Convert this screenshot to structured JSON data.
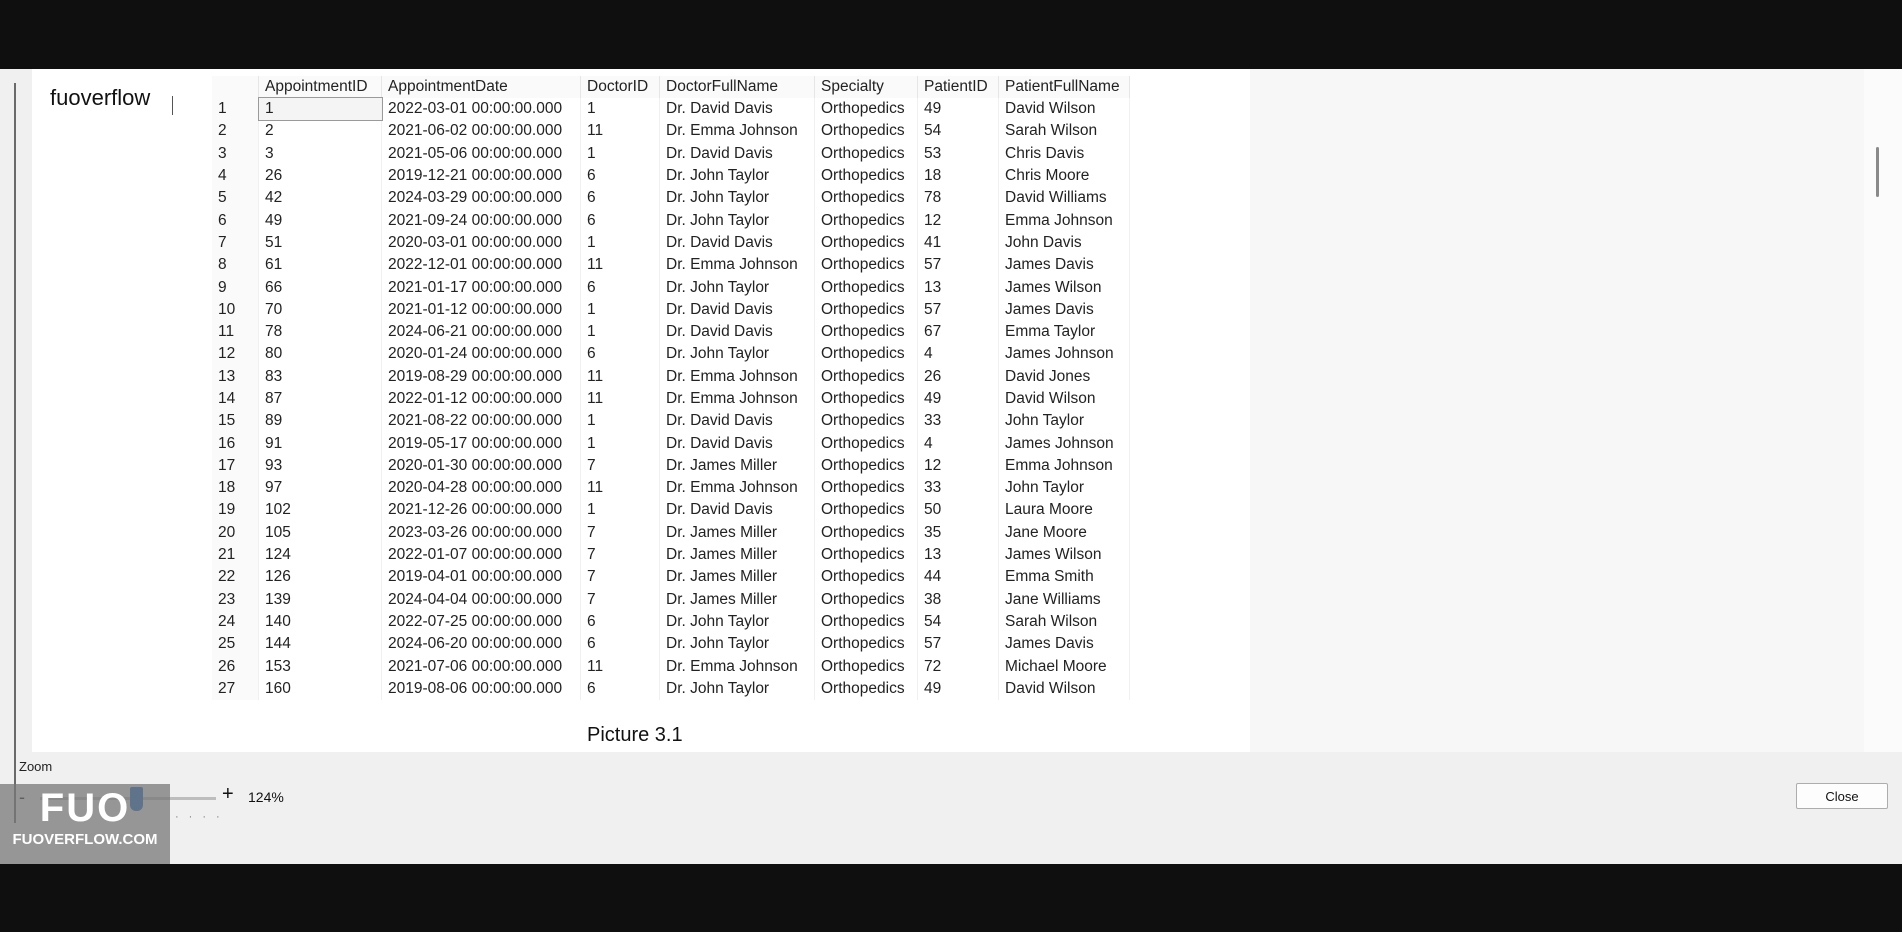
{
  "overlay_label": "fuoverflow",
  "table": {
    "columns": [
      "",
      "AppointmentID",
      "AppointmentDate",
      "DoctorID",
      "DoctorFullName",
      "Specialty",
      "PatientID",
      "PatientFullName"
    ],
    "rows": [
      [
        "1",
        "1",
        "2022-03-01 00:00:00.000",
        "1",
        "Dr. David Davis",
        "Orthopedics",
        "49",
        "David Wilson"
      ],
      [
        "2",
        "2",
        "2021-06-02 00:00:00.000",
        "11",
        "Dr. Emma Johnson",
        "Orthopedics",
        "54",
        "Sarah Wilson"
      ],
      [
        "3",
        "3",
        "2021-05-06 00:00:00.000",
        "1",
        "Dr. David Davis",
        "Orthopedics",
        "53",
        "Chris Davis"
      ],
      [
        "4",
        "26",
        "2019-12-21 00:00:00.000",
        "6",
        "Dr. John Taylor",
        "Orthopedics",
        "18",
        "Chris Moore"
      ],
      [
        "5",
        "42",
        "2024-03-29 00:00:00.000",
        "6",
        "Dr. John Taylor",
        "Orthopedics",
        "78",
        "David Williams"
      ],
      [
        "6",
        "49",
        "2021-09-24 00:00:00.000",
        "6",
        "Dr. John Taylor",
        "Orthopedics",
        "12",
        "Emma Johnson"
      ],
      [
        "7",
        "51",
        "2020-03-01 00:00:00.000",
        "1",
        "Dr. David Davis",
        "Orthopedics",
        "41",
        "John Davis"
      ],
      [
        "8",
        "61",
        "2022-12-01 00:00:00.000",
        "11",
        "Dr. Emma Johnson",
        "Orthopedics",
        "57",
        "James Davis"
      ],
      [
        "9",
        "66",
        "2021-01-17 00:00:00.000",
        "6",
        "Dr. John Taylor",
        "Orthopedics",
        "13",
        "James Wilson"
      ],
      [
        "10",
        "70",
        "2021-01-12 00:00:00.000",
        "1",
        "Dr. David Davis",
        "Orthopedics",
        "57",
        "James Davis"
      ],
      [
        "11",
        "78",
        "2024-06-21 00:00:00.000",
        "1",
        "Dr. David Davis",
        "Orthopedics",
        "67",
        "Emma Taylor"
      ],
      [
        "12",
        "80",
        "2020-01-24 00:00:00.000",
        "6",
        "Dr. John Taylor",
        "Orthopedics",
        "4",
        "James Johnson"
      ],
      [
        "13",
        "83",
        "2019-08-29 00:00:00.000",
        "11",
        "Dr. Emma Johnson",
        "Orthopedics",
        "26",
        "David Jones"
      ],
      [
        "14",
        "87",
        "2022-01-12 00:00:00.000",
        "11",
        "Dr. Emma Johnson",
        "Orthopedics",
        "49",
        "David Wilson"
      ],
      [
        "15",
        "89",
        "2021-08-22 00:00:00.000",
        "1",
        "Dr. David Davis",
        "Orthopedics",
        "33",
        "John Taylor"
      ],
      [
        "16",
        "91",
        "2019-05-17 00:00:00.000",
        "1",
        "Dr. David Davis",
        "Orthopedics",
        "4",
        "James Johnson"
      ],
      [
        "17",
        "93",
        "2020-01-30 00:00:00.000",
        "7",
        "Dr. James Miller",
        "Orthopedics",
        "12",
        "Emma Johnson"
      ],
      [
        "18",
        "97",
        "2020-04-28 00:00:00.000",
        "11",
        "Dr. Emma Johnson",
        "Orthopedics",
        "33",
        "John Taylor"
      ],
      [
        "19",
        "102",
        "2021-12-26 00:00:00.000",
        "1",
        "Dr. David Davis",
        "Orthopedics",
        "50",
        "Laura Moore"
      ],
      [
        "20",
        "105",
        "2023-03-26 00:00:00.000",
        "7",
        "Dr. James Miller",
        "Orthopedics",
        "35",
        "Jane Moore"
      ],
      [
        "21",
        "124",
        "2022-01-07 00:00:00.000",
        "7",
        "Dr. James Miller",
        "Orthopedics",
        "13",
        "James Wilson"
      ],
      [
        "22",
        "126",
        "2019-04-01 00:00:00.000",
        "7",
        "Dr. James Miller",
        "Orthopedics",
        "44",
        "Emma Smith"
      ],
      [
        "23",
        "139",
        "2024-04-04 00:00:00.000",
        "7",
        "Dr. James Miller",
        "Orthopedics",
        "38",
        "Jane Williams"
      ],
      [
        "24",
        "140",
        "2022-07-25 00:00:00.000",
        "6",
        "Dr. John Taylor",
        "Orthopedics",
        "54",
        "Sarah Wilson"
      ],
      [
        "25",
        "144",
        "2024-06-20 00:00:00.000",
        "6",
        "Dr. John Taylor",
        "Orthopedics",
        "57",
        "James Davis"
      ],
      [
        "26",
        "153",
        "2021-07-06 00:00:00.000",
        "11",
        "Dr. Emma Johnson",
        "Orthopedics",
        "72",
        "Michael Moore"
      ],
      [
        "27",
        "160",
        "2019-08-06 00:00:00.000",
        "6",
        "Dr. John Taylor",
        "Orthopedics",
        "49",
        "David Wilson"
      ]
    ]
  },
  "caption": "Picture 3.1",
  "zoom": {
    "label": "Zoom",
    "minus": "-",
    "plus": "+",
    "value_text": "124%",
    "level_fraction": 0.55
  },
  "close_label": "Close",
  "watermark": {
    "logo": "FUO",
    "site": "FUOVERFLOW.COM"
  },
  "colors": {
    "slider_accent": "#1565c0",
    "background_bars": "#0f0f0f"
  }
}
